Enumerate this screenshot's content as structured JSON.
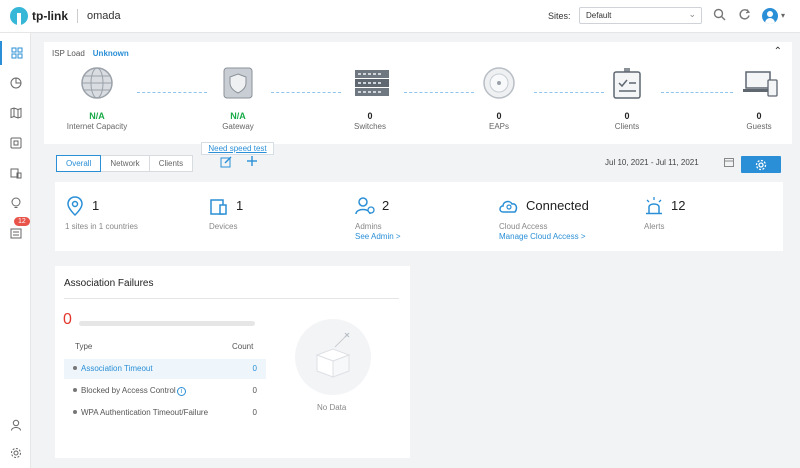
{
  "header": {
    "brand": "tp-link",
    "product": "omada",
    "sites_label": "Sites:",
    "site_selected": "Default"
  },
  "sidebar": {
    "badge_count": "12"
  },
  "topology": {
    "isp_label": "ISP Load",
    "isp_value": "Unknown",
    "nodes": [
      {
        "value": "N/A",
        "label": "Internet Capacity"
      },
      {
        "value": "N/A",
        "label": "Gateway"
      },
      {
        "value": "0",
        "label": "Switches"
      },
      {
        "value": "0",
        "label": "EAPs"
      },
      {
        "value": "0",
        "label": "Clients"
      },
      {
        "value": "0",
        "label": "Guests"
      }
    ],
    "speed_test_link": "Need speed test"
  },
  "tabs": [
    {
      "label": "Overall"
    },
    {
      "label": "Network"
    },
    {
      "label": "Clients"
    }
  ],
  "date_range": "Jul 10, 2021  - Jul 11, 2021",
  "summary": {
    "sites": {
      "count": "1",
      "sub": "1 sites in 1 countries"
    },
    "devices": {
      "count": "1",
      "sub": "Devices"
    },
    "admins": {
      "count": "2",
      "sub": "Admins",
      "link": "See Admin >"
    },
    "cloud": {
      "status": "Connected",
      "sub": "Cloud Access",
      "link": "Manage Cloud Access >"
    },
    "alerts": {
      "count": "12",
      "sub": "Alerts"
    }
  },
  "association_failures": {
    "title": "Association Failures",
    "total": "0",
    "col_type": "Type",
    "col_count": "Count",
    "rows": [
      {
        "type": "Association Timeout",
        "count": "0"
      },
      {
        "type": "Blocked by Access Control",
        "count": "0"
      },
      {
        "type": "WPA Authentication Timeout/Failure",
        "count": "0"
      }
    ],
    "empty_text": "No Data"
  },
  "colors": {
    "accent": "#2a8fd6",
    "success": "#1aab49",
    "danger": "#e3352a"
  }
}
